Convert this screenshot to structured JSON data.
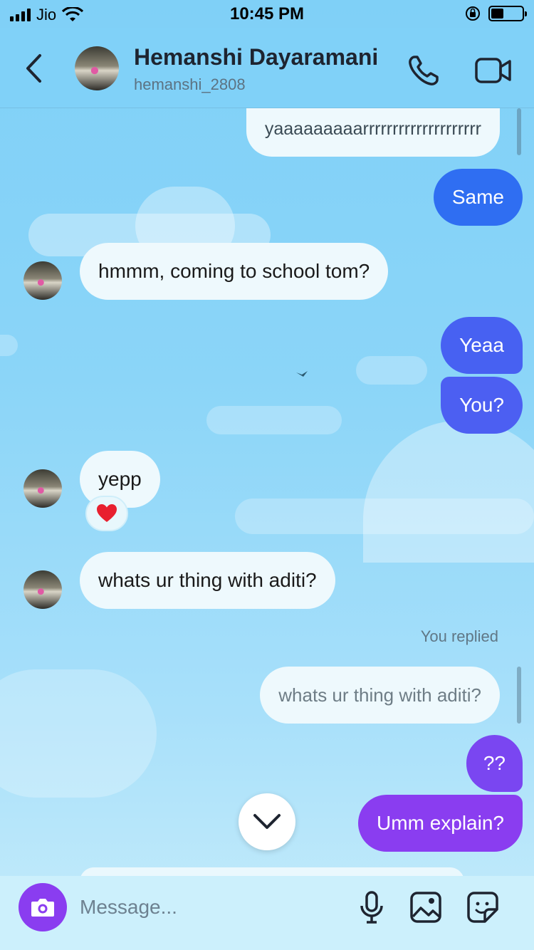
{
  "status_bar": {
    "carrier": "Jio",
    "time": "10:45 PM"
  },
  "header": {
    "name": "Hemanshi Dayaramani",
    "username": "hemanshi_2808"
  },
  "messages": [
    {
      "from": "me",
      "text": "yaaaaaaaaarrrrrrrrrrrrrrrrrrrr"
    },
    {
      "from": "me",
      "text": "Same"
    },
    {
      "from": "them",
      "text": "hmmm, coming to school tom?"
    },
    {
      "from": "me",
      "text": "Yeaa"
    },
    {
      "from": "me",
      "text": "You?"
    },
    {
      "from": "them",
      "text": "yepp",
      "reaction": "❤️"
    },
    {
      "from": "them",
      "text": "whats ur thing with aditi?"
    },
    {
      "from": "me",
      "text": "??"
    },
    {
      "from": "me",
      "text": "Umm explain?"
    }
  ],
  "reply": {
    "label": "You replied",
    "quoted_text": "whats ur thing with aditi?"
  },
  "composer": {
    "placeholder": "Message..."
  },
  "colors": {
    "out_blue": "#2f6ef2",
    "out_indigo": "#4c5ff2",
    "out_purple": "#8a3df0",
    "incoming": "#eef9fd"
  }
}
